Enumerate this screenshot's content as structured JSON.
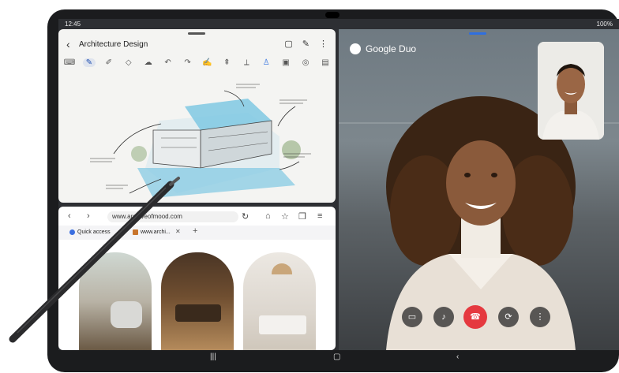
{
  "status_bar": {
    "time": "12:45",
    "right": "100%"
  },
  "notes": {
    "title": "Architecture Design",
    "header_icons": [
      "book-icon",
      "pen-icon",
      "more-icon"
    ],
    "tools": [
      "keyboard",
      "pen",
      "highlighter",
      "eraser",
      "lasso",
      "undo",
      "redo",
      "brush",
      "text",
      "ruler",
      "pen-selected",
      "insert",
      "shapes",
      "pages"
    ]
  },
  "browser": {
    "url": "www.archiveofmood.com",
    "tabs": [
      {
        "label": "Quick access",
        "color": "#3b6fe0"
      },
      {
        "label": "www.archi...",
        "color": "#c8742b"
      }
    ]
  },
  "duo": {
    "app_name": "Google Duo",
    "controls": [
      "camera-off-icon",
      "mic-off-icon",
      "end-call-icon",
      "flip-camera-icon",
      "more-icon"
    ]
  },
  "colors": {
    "end_call": "#e5393f",
    "duo_handle": "#2f6fe0",
    "active_tool": "#1f4fb0"
  }
}
